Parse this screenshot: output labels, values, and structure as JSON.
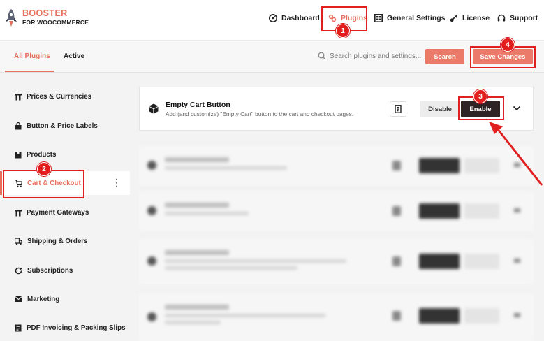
{
  "brand": {
    "line1": "BOOSTER",
    "line2": "FOR WOOCOMMERCE",
    "accent_color": "#e76f5e"
  },
  "nav": {
    "dashboard": "Dashboard",
    "plugins": "Plugins",
    "general_settings": "General Settings",
    "license": "License",
    "support": "Support"
  },
  "tabs": {
    "all_plugins": "All Plugins",
    "active": "Active"
  },
  "search": {
    "placeholder": "Search plugins and settings...",
    "button_label": "Search"
  },
  "save_changes_label": "Save Changes",
  "sidebar": {
    "items": [
      {
        "label": "Prices & Currencies",
        "icon": "tag-icon"
      },
      {
        "label": "Button & Price Labels",
        "icon": "bag-icon"
      },
      {
        "label": "Products",
        "icon": "box-icon"
      },
      {
        "label": "Cart & Checkout",
        "icon": "cart-icon",
        "active": true
      },
      {
        "label": "Payment Gateways",
        "icon": "wallet-icon"
      },
      {
        "label": "Shipping & Orders",
        "icon": "truck-icon"
      },
      {
        "label": "Subscriptions",
        "icon": "refresh-icon"
      },
      {
        "label": "Marketing",
        "icon": "mail-icon"
      },
      {
        "label": "PDF Invoicing & Packing Slips",
        "icon": "invoice-icon"
      }
    ]
  },
  "plugin": {
    "title": "Empty Cart Button",
    "description": "Add (and customize) \"Empty Cart\" button to the cart and checkout pages.",
    "disable_label": "Disable",
    "enable_label": "Enable"
  },
  "annotations": {
    "markers": [
      "1",
      "2",
      "3",
      "4"
    ],
    "color": "#e02020"
  }
}
